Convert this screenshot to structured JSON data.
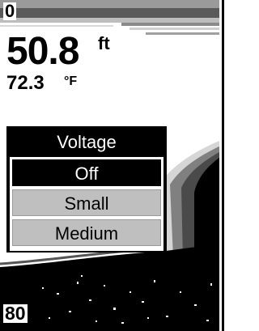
{
  "display": {
    "range_top": "0",
    "range_bottom": "80",
    "depth": {
      "value": "50.8",
      "unit": "ft"
    },
    "temperature": {
      "value": "72.3",
      "unit": "°F"
    }
  },
  "menu": {
    "title": "Voltage",
    "items": [
      {
        "label": "Off",
        "selected": true
      },
      {
        "label": "Small",
        "selected": false
      },
      {
        "label": "Medium",
        "selected": false
      }
    ]
  },
  "colors": {
    "background": "#ffffff",
    "bottom_band": "#000000",
    "gray_band": "#7f7f7f",
    "light_band": "#bfbfbf",
    "menu_frame": "#000000",
    "selected_item": "#000000",
    "unselected_item": "#bfbfbf"
  }
}
